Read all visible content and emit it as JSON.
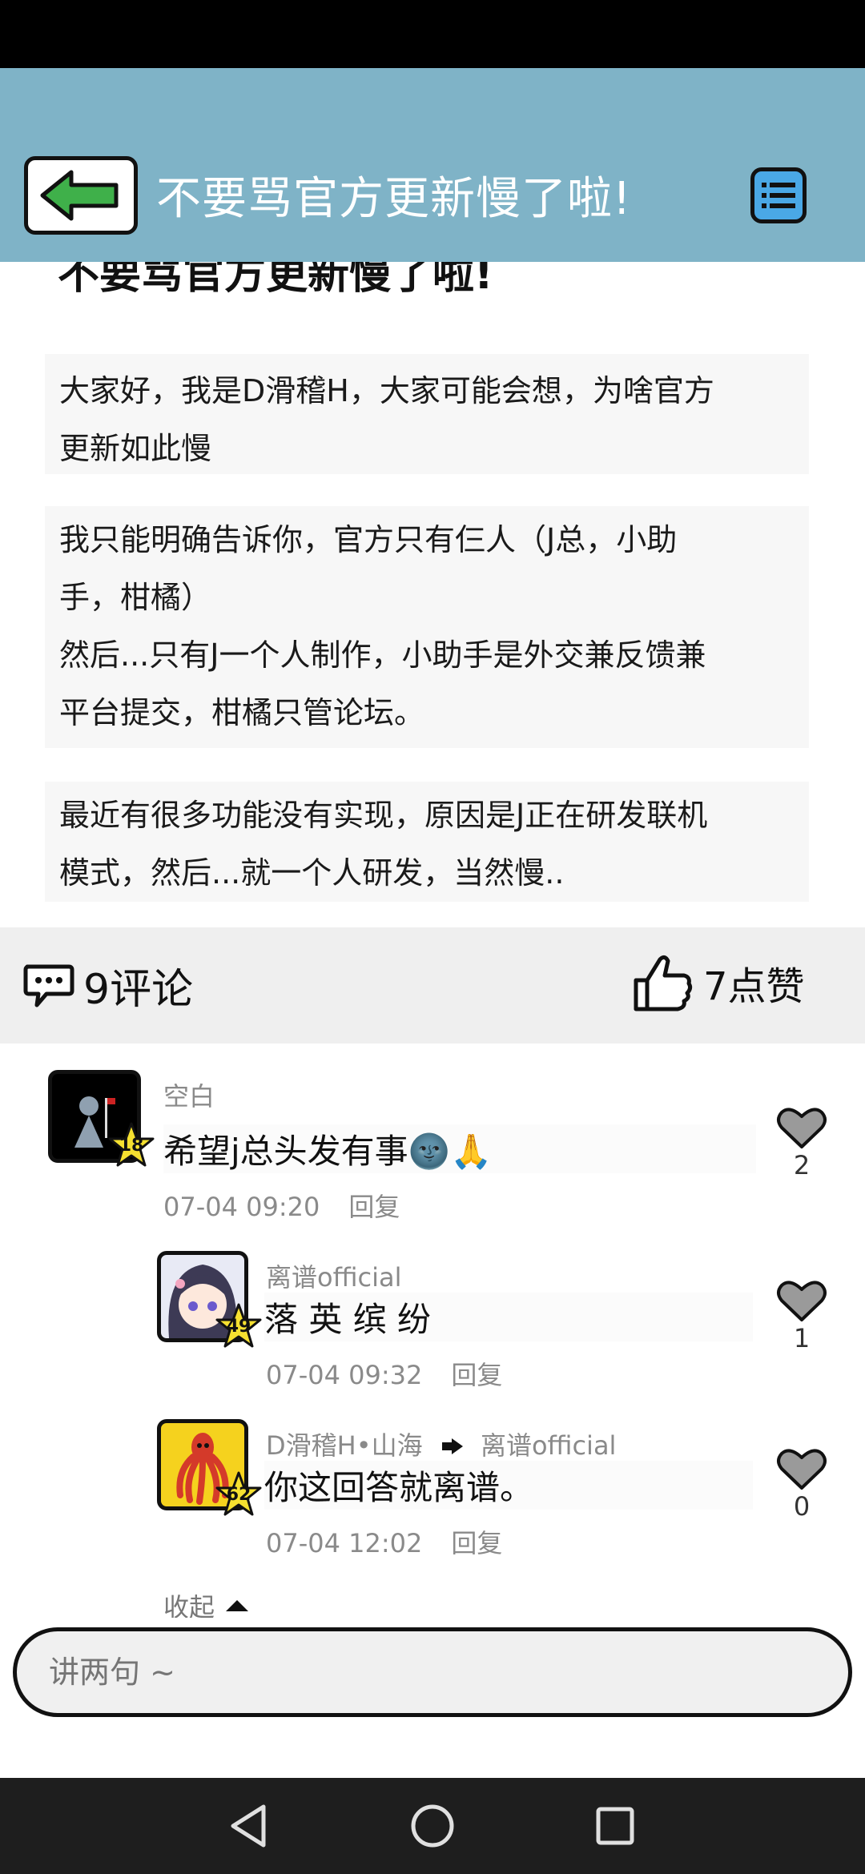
{
  "app_bar": {
    "title": "不要骂官方更新慢了啦!",
    "bg_color": "#7fb3c7"
  },
  "article": {
    "heading": "不要骂官方更新慢了啦!",
    "paragraphs": [
      [
        "大家好，我是D滑稽H，大家可能会想，为啥官方",
        "更新如此慢"
      ],
      [
        "我只能明确告诉你，官方只有仨人（J总，小助",
        "手，柑橘）",
        "然后...只有J一个人制作，小助手是外交兼反馈兼",
        "平台提交，柑橘只管论坛。"
      ],
      [
        "最近有很多功能没有实现，原因是J正在研发联机",
        "模式，然后...就一个人研发，当然慢.."
      ]
    ]
  },
  "stats": {
    "comments_label": "9评论",
    "likes_label": "7点赞"
  },
  "comments": [
    {
      "username": "空白",
      "text": "希望j总头发有事🌚🙏",
      "time": "07-04 09:20",
      "reply": "回复",
      "level": "18",
      "likes": "2"
    },
    {
      "username": "离谱official",
      "text": "落 英 缤 纷",
      "time": "07-04 09:32",
      "reply": "回复",
      "level": "49",
      "likes": "1"
    },
    {
      "username": "D滑稽H•山海",
      "reply_to": "离谱official",
      "text": "你这回答就离谱。",
      "time": "07-04 12:02",
      "reply": "回复",
      "level": "62",
      "likes": "0"
    }
  ],
  "collapse_label": "收起",
  "input": {
    "placeholder": "讲两句 ~"
  },
  "icons": [
    "back-arrow-icon",
    "menu-list-icon",
    "comment-bubble-icon",
    "thumbs-up-icon",
    "heart-icon",
    "star-badge-icon",
    "nav-back-icon",
    "nav-home-icon",
    "nav-recents-icon"
  ]
}
